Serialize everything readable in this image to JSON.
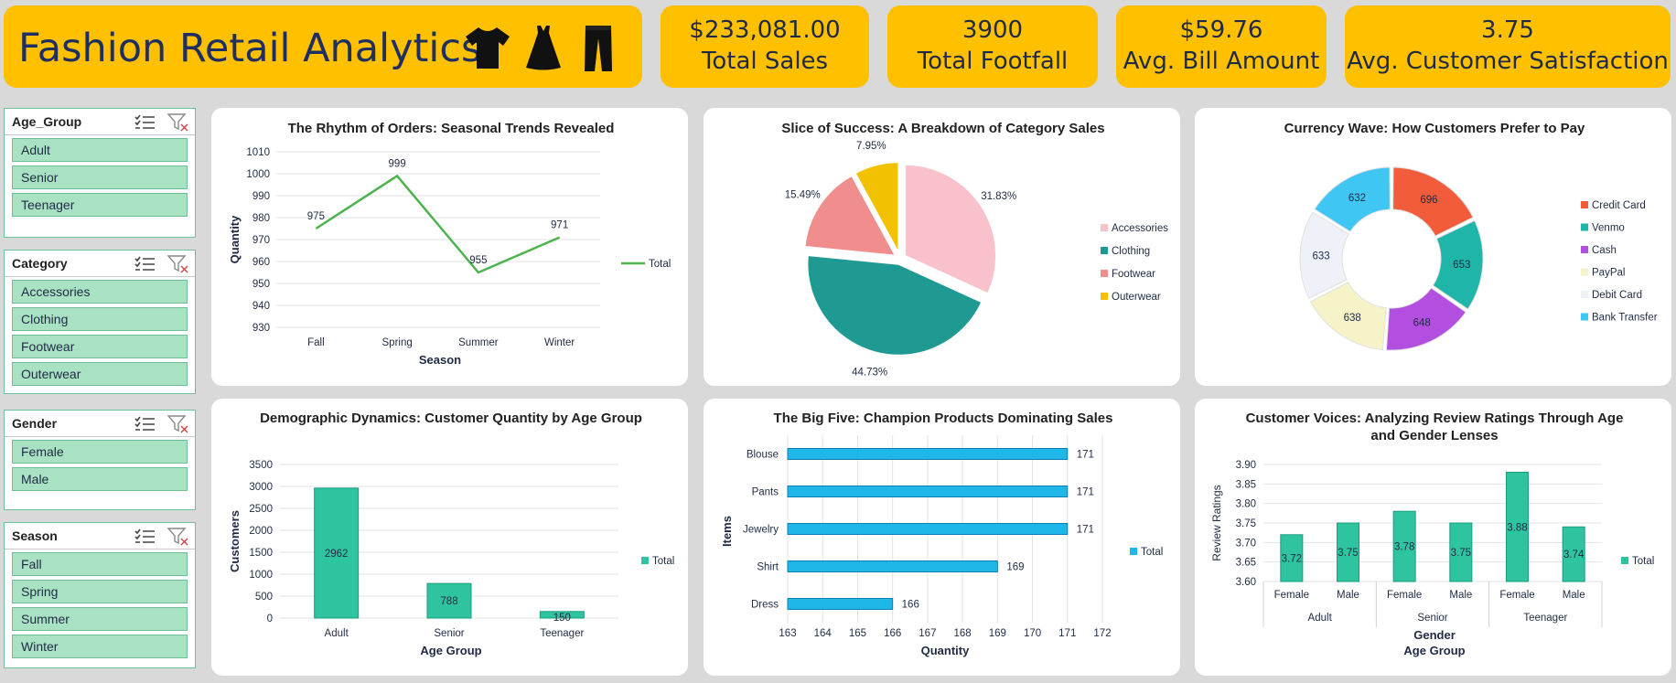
{
  "header": {
    "title": "Fashion Retail Analytics",
    "icons": [
      "tshirt-icon",
      "dress-icon",
      "pants-icon"
    ]
  },
  "kpis": [
    {
      "value": "$233,081.00",
      "label": "Total Sales"
    },
    {
      "value": "3900",
      "label": "Total Footfall"
    },
    {
      "value": "$59.76",
      "label": "Avg. Bill Amount"
    },
    {
      "value": "3.75",
      "label": "Avg. Customer Satisfaction"
    }
  ],
  "slicers": [
    {
      "title": "Age_Group",
      "items": [
        "Adult",
        "Senior",
        "Teenager"
      ]
    },
    {
      "title": "Category",
      "items": [
        "Accessories",
        "Clothing",
        "Footwear",
        "Outerwear"
      ]
    },
    {
      "title": "Gender",
      "items": [
        "Female",
        "Male"
      ]
    },
    {
      "title": "Season",
      "items": [
        "Fall",
        "Spring",
        "Summer",
        "Winter"
      ]
    }
  ],
  "colors": {
    "accent": "#ffc000",
    "slicer_item": "#a9e2c3",
    "line": "#4db34d",
    "teal_bar": "#2ec4a0",
    "blue_bar": "#1fb6e8"
  },
  "chart_data": [
    {
      "id": "seasonal",
      "type": "line",
      "title": "The Rhythm of Orders: Seasonal Trends Revealed",
      "categories": [
        "Fall",
        "Spring",
        "Summer",
        "Winter"
      ],
      "series": [
        {
          "name": "Total",
          "values": [
            975,
            999,
            955,
            971
          ]
        }
      ],
      "xlabel": "Season",
      "ylabel": "Quantity",
      "ylim": [
        930,
        1010
      ],
      "yticks": [
        "930",
        "940",
        "950",
        "960",
        "970",
        "980",
        "990",
        "1000",
        "1010"
      ],
      "legend": "right"
    },
    {
      "id": "category",
      "type": "pie",
      "title": "Slice of Success: A Breakdown of Category Sales",
      "categories": [
        "Accessories",
        "Clothing",
        "Footwear",
        "Outerwear"
      ],
      "values": [
        31.83,
        44.73,
        15.49,
        7.95
      ],
      "labels": [
        "31.83%",
        "44.73%",
        "15.49%",
        "7.95%"
      ],
      "colors": [
        "#f8c1cc",
        "#1f9a93",
        "#f08e8e",
        "#f2c200"
      ],
      "legend": "right"
    },
    {
      "id": "payment",
      "type": "pie",
      "title": "Currency Wave: How Customers Prefer to Pay",
      "categories": [
        "Credit Card",
        "Venmo",
        "Cash",
        "PayPal",
        "Debit Card",
        "Bank Transfer"
      ],
      "values": [
        696,
        653,
        648,
        638,
        633,
        632
      ],
      "colors": [
        "#f25c3b",
        "#1fb5a8",
        "#b34fe0",
        "#f6f3c8",
        "#eef2f8",
        "#3fc6f2"
      ],
      "legend": "right"
    },
    {
      "id": "agegroup",
      "type": "bar",
      "title": "Demographic Dynamics: Customer Quantity by Age Group",
      "categories": [
        "Adult",
        "Senior",
        "Teenager"
      ],
      "series": [
        {
          "name": "Total",
          "values": [
            2962,
            788,
            150
          ]
        }
      ],
      "xlabel": "Age Group",
      "ylabel": "Customers",
      "ylim": [
        0,
        3500
      ],
      "yticks": [
        "0",
        "500",
        "1000",
        "1500",
        "2000",
        "2500",
        "3000",
        "3500"
      ],
      "legend": "right"
    },
    {
      "id": "products",
      "type": "bar",
      "orientation": "horizontal",
      "title": "The Big Five: Champion Products Dominating Sales",
      "categories": [
        "Blouse",
        "Pants",
        "Jewelry",
        "Shirt",
        "Dress"
      ],
      "series": [
        {
          "name": "Total",
          "values": [
            171,
            171,
            171,
            169,
            166
          ]
        }
      ],
      "xlabel": "Quantity",
      "ylabel": "Items",
      "xlim": [
        163,
        172
      ],
      "xticks": [
        "163",
        "164",
        "165",
        "166",
        "167",
        "168",
        "169",
        "170",
        "171",
        "172"
      ],
      "legend": "right"
    },
    {
      "id": "reviews",
      "type": "bar",
      "title": "Customer Voices: Analyzing Review Ratings Through Age and Gender Lenses",
      "categories": [
        "Female",
        "Male",
        "Female",
        "Male",
        "Female",
        "Male"
      ],
      "groups": [
        "Adult",
        "Senior",
        "Teenager"
      ],
      "series": [
        {
          "name": "Total",
          "values": [
            3.72,
            3.75,
            3.78,
            3.75,
            3.88,
            3.74
          ]
        }
      ],
      "labels": [
        "3.72",
        "3.75",
        "3.78",
        "3.75",
        "3.88",
        "3.74"
      ],
      "xlabel": "Gender",
      "xlabel2": "Age Group",
      "ylabel": "Review Ratings",
      "ylim": [
        3.6,
        3.9
      ],
      "yticks": [
        "3.60",
        "3.65",
        "3.70",
        "3.75",
        "3.80",
        "3.85",
        "3.90"
      ],
      "legend": "right"
    }
  ]
}
